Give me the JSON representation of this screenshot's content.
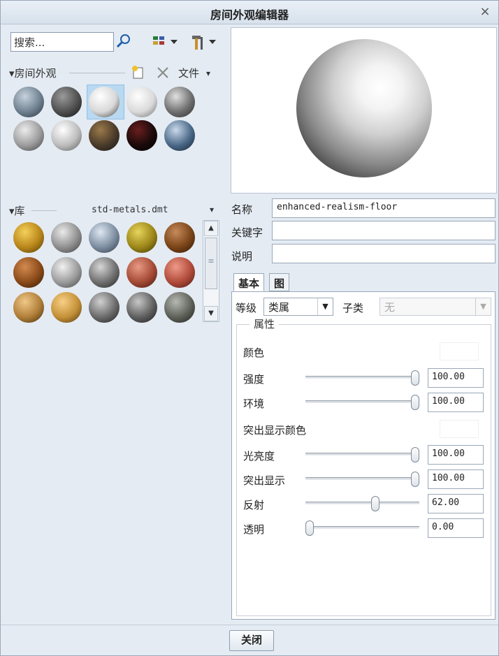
{
  "window": {
    "title": "房间外观编辑器",
    "close_glyph": "×"
  },
  "search": {
    "placeholder": "搜索..."
  },
  "room_section": {
    "label": "▾房间外观",
    "file_menu": "文件",
    "file_arrow": "▾"
  },
  "room_swatches": [
    {
      "colors": [
        "#c6d2dc",
        "#6f8190",
        "#27323a"
      ]
    },
    {
      "colors": [
        "#9a9a9a",
        "#4f4f4f",
        "#121212"
      ]
    },
    {
      "colors": [
        "#ffffff",
        "#d8d8d8",
        "#3c3c3c"
      ]
    },
    {
      "colors": [
        "#ffffff",
        "#dadada",
        "#6c6c6c"
      ]
    },
    {
      "colors": [
        "#e0e0e0",
        "#6f6f6f",
        "#2a2a2a"
      ]
    },
    {
      "colors": [
        "#ececec",
        "#9c9c9c",
        "#3d3d3d"
      ]
    },
    {
      "colors": [
        "#ffffff",
        "#bdbdbd",
        "#585858"
      ]
    },
    {
      "colors": [
        "#9a7a4a",
        "#4a3a2a",
        "#141414"
      ]
    },
    {
      "colors": [
        "#6a1e1e",
        "#1a0a0a",
        "#000000"
      ]
    },
    {
      "colors": [
        "#c9d9ea",
        "#4a6888",
        "#14202e"
      ]
    }
  ],
  "library": {
    "label": "▾库",
    "file": "std-metals.dmt",
    "arrow": "▾"
  },
  "library_swatches": [
    {
      "colors": [
        "#f5d05a",
        "#b8861a",
        "#4d3606"
      ]
    },
    {
      "colors": [
        "#eaeaea",
        "#8f8f8f",
        "#3c3c3c"
      ]
    },
    {
      "colors": [
        "#dde7f2",
        "#7c8da0",
        "#2c3644"
      ]
    },
    {
      "colors": [
        "#e6d45c",
        "#9c8618",
        "#3c3205"
      ]
    },
    {
      "colors": [
        "#c78a5a",
        "#7a4418",
        "#2c1404"
      ]
    },
    {
      "colors": [
        "#d38a50",
        "#8a4a18",
        "#2d1605"
      ]
    },
    {
      "colors": [
        "#f1f1f1",
        "#9b9b9b",
        "#424242"
      ]
    },
    {
      "colors": [
        "#d6d6d6",
        "#6f6f6f",
        "#222222"
      ]
    },
    {
      "colors": [
        "#e89a84",
        "#a44a35",
        "#3e1510"
      ]
    },
    {
      "colors": [
        "#ef9a88",
        "#b04a3a",
        "#441812"
      ]
    },
    {
      "colors": [
        "#f1c888",
        "#b07e38",
        "#3e2a0c"
      ]
    },
    {
      "colors": [
        "#f7cf84",
        "#c49038",
        "#4a320c"
      ]
    },
    {
      "colors": [
        "#d0d0d0",
        "#6a6a6a",
        "#1e1e1e"
      ]
    },
    {
      "colors": [
        "#c7c7c7",
        "#5f5f5f",
        "#1b1b1b"
      ]
    },
    {
      "colors": [
        "#b5b9b2",
        "#5d6158",
        "#1e1f1b"
      ]
    }
  ],
  "scrollbar": {
    "up": "▲",
    "grip": "≡",
    "down": "▼"
  },
  "fields": {
    "name_label": "名称",
    "name_value": "enhanced-realism-floor",
    "keyword_label": "关键字",
    "keyword_value": "",
    "desc_label": "说明",
    "desc_value": ""
  },
  "tabs": [
    {
      "label": "基本",
      "active": true
    },
    {
      "label": "图",
      "active": false
    }
  ],
  "class_row": {
    "grade_label": "等级",
    "grade_value": "类属",
    "sub_label": "子类",
    "sub_value": "无",
    "arrow": "▼"
  },
  "properties": {
    "group_title": "属性",
    "color_label": "颜色",
    "intensity_label": "强度",
    "intensity_value": "100.00",
    "ambient_label": "环境",
    "ambient_value": "100.00",
    "highlight_color_label": "突出显示颜色",
    "shininess_label": "光亮度",
    "shininess_value": "100.00",
    "highlight_label": "突出显示",
    "highlight_value": "100.00",
    "reflection_label": "反射",
    "reflection_value": "62.00",
    "transparency_label": "透明",
    "transparency_value": "0.00"
  },
  "slider_levels": {
    "intensity": 1.0,
    "ambient": 1.0,
    "shininess": 1.0,
    "highlight": 1.0,
    "reflection": 0.62,
    "transparency": 0.0
  },
  "footer": {
    "close_label": "关闭"
  }
}
